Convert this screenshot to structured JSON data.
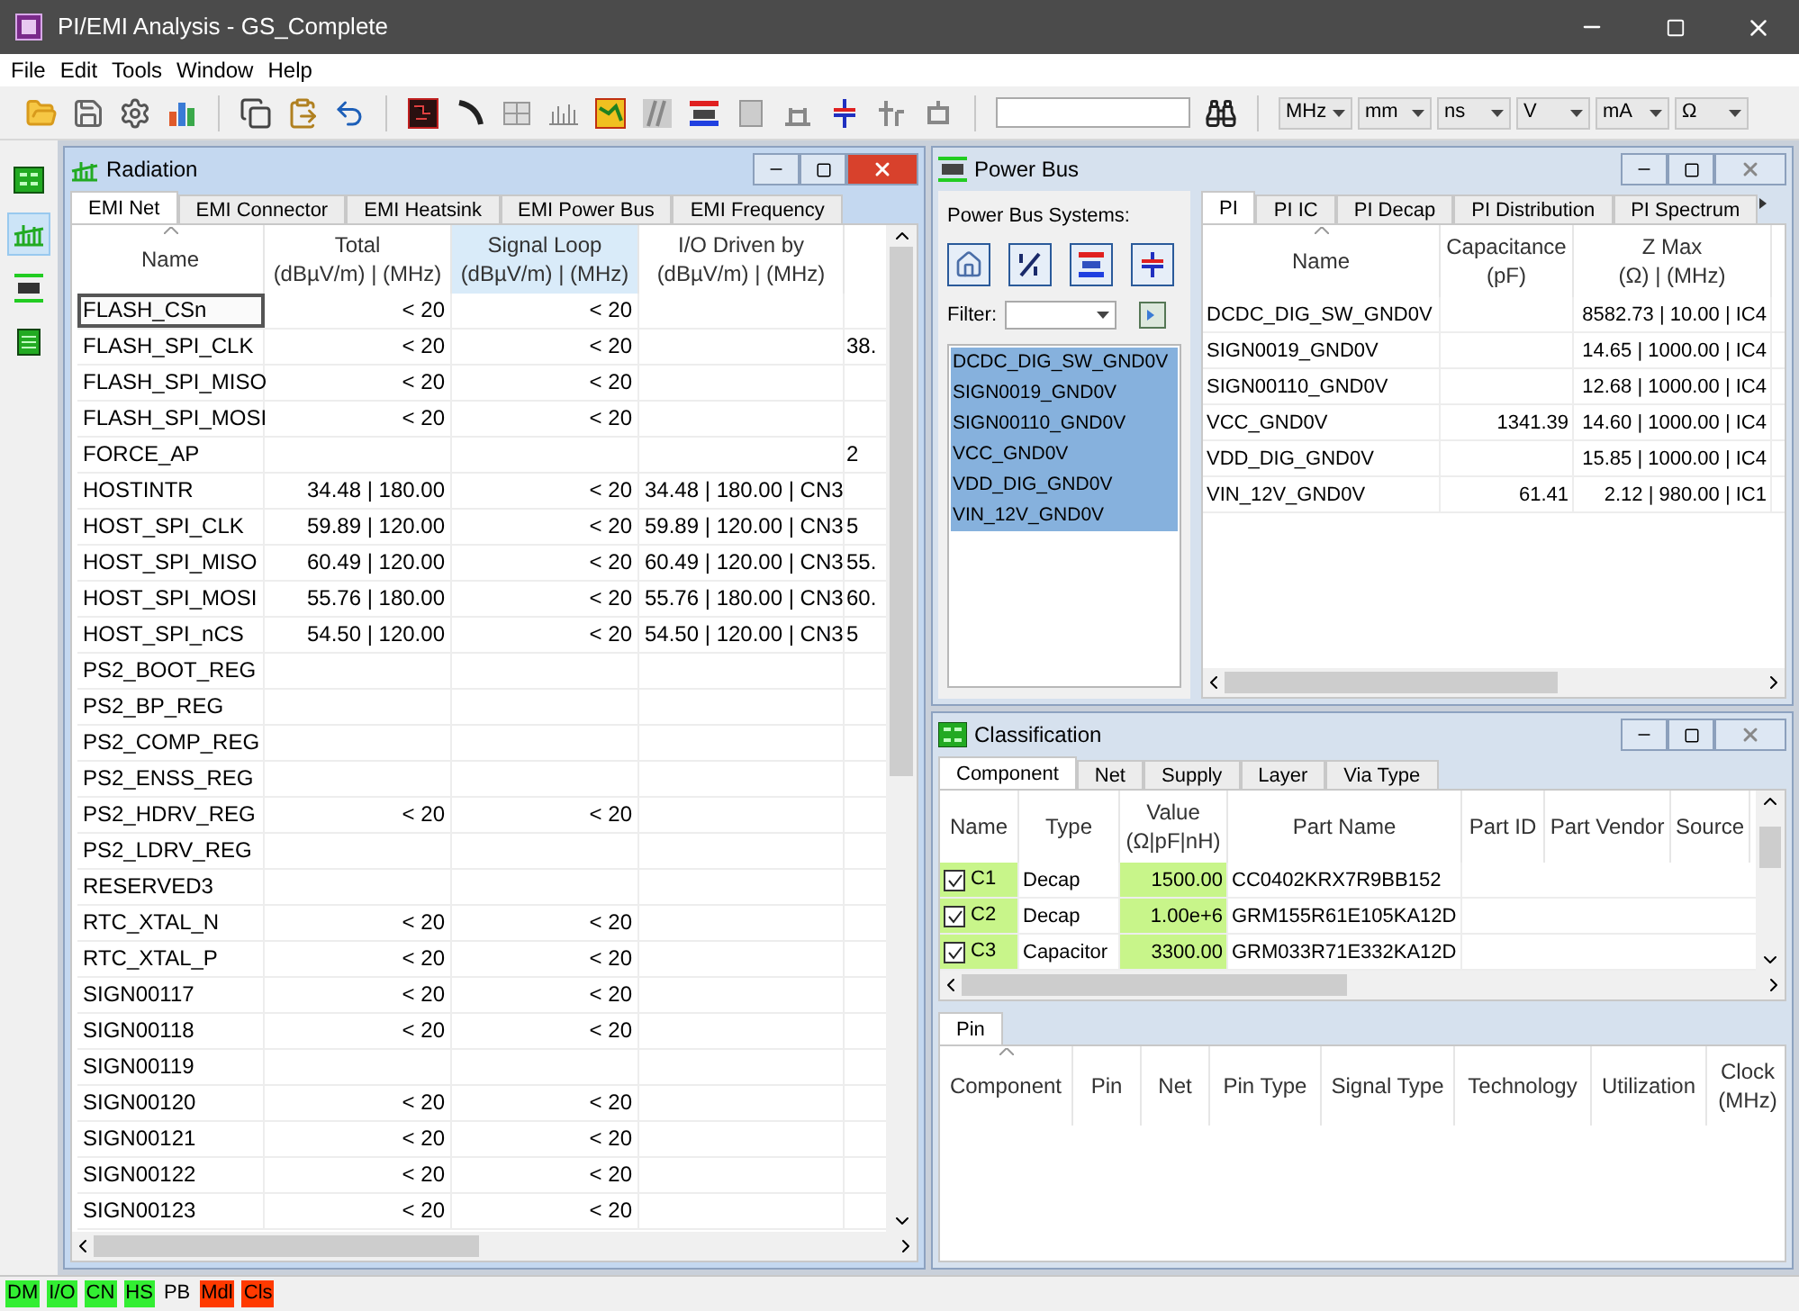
{
  "window": {
    "title": "PI/EMI Analysis - GS_Complete"
  },
  "menu": [
    "File",
    "Edit",
    "Tools",
    "Window",
    "Help"
  ],
  "units": [
    "MHz",
    "mm",
    "ns",
    "V",
    "mA",
    "Ω"
  ],
  "side_tools": [
    {
      "selected": false
    },
    {
      "selected": true
    },
    {
      "selected": false
    },
    {
      "selected": false
    }
  ],
  "radiation": {
    "title": "Radiation",
    "active": true,
    "tabs": [
      {
        "label": "EMI Net",
        "selected": true
      },
      {
        "label": "EMI Connector",
        "selected": false
      },
      {
        "label": "EMI Heatsink",
        "selected": false
      },
      {
        "label": "EMI Power Bus",
        "selected": false
      },
      {
        "label": "EMI Frequency",
        "selected": false
      }
    ],
    "columns": [
      {
        "label": "Name",
        "selected": false
      },
      {
        "label": "Total",
        "unit": "(dBµV/m) | (MHz)",
        "selected": false
      },
      {
        "label": "Signal Loop",
        "unit": "(dBµV/m) | (MHz)",
        "selected": true
      },
      {
        "label": "I/O Driven by",
        "unit": "(dBµV/m) | (MHz)",
        "selected": false
      }
    ],
    "rows": [
      {
        "focused": true,
        "cells": [
          "FLASH_CSn",
          "< 20",
          "< 20",
          null,
          null
        ]
      },
      {
        "focused": false,
        "cells": [
          "FLASH_SPI_CLK",
          "< 20",
          "< 20",
          null,
          "38."
        ]
      },
      {
        "focused": false,
        "cells": [
          "FLASH_SPI_MISO",
          "< 20",
          "< 20",
          null,
          null
        ]
      },
      {
        "focused": false,
        "cells": [
          "FLASH_SPI_MOSI",
          "< 20",
          "< 20",
          null,
          null
        ]
      },
      {
        "focused": false,
        "cells": [
          "FORCE_AP",
          null,
          null,
          null,
          "2"
        ]
      },
      {
        "focused": false,
        "cells": [
          "HOSTINTR",
          "34.48 | 180.00",
          "< 20",
          "34.48 | 180.00 | CN3",
          null
        ]
      },
      {
        "focused": false,
        "cells": [
          "HOST_SPI_CLK",
          "59.89 | 120.00",
          "< 20",
          "59.89 | 120.00 | CN3",
          "5"
        ]
      },
      {
        "focused": false,
        "cells": [
          "HOST_SPI_MISO",
          "60.49 | 120.00",
          "< 20",
          "60.49 | 120.00 | CN3",
          "55."
        ]
      },
      {
        "focused": false,
        "cells": [
          "HOST_SPI_MOSI",
          "55.76 | 180.00",
          "< 20",
          "55.76 | 180.00 | CN3",
          "60."
        ]
      },
      {
        "focused": false,
        "cells": [
          "HOST_SPI_nCS",
          "54.50 | 120.00",
          "< 20",
          "54.50 | 120.00 | CN3",
          "5"
        ]
      },
      {
        "focused": false,
        "cells": [
          "PS2_BOOT_REG",
          null,
          null,
          null,
          null
        ]
      },
      {
        "focused": false,
        "cells": [
          "PS2_BP_REG",
          null,
          null,
          null,
          null
        ]
      },
      {
        "focused": false,
        "cells": [
          "PS2_COMP_REG",
          null,
          null,
          null,
          null
        ]
      },
      {
        "focused": false,
        "cells": [
          "PS2_ENSS_REG",
          null,
          null,
          null,
          null
        ]
      },
      {
        "focused": false,
        "cells": [
          "PS2_HDRV_REG",
          "< 20",
          "< 20",
          null,
          null
        ]
      },
      {
        "focused": false,
        "cells": [
          "PS2_LDRV_REG",
          null,
          null,
          null,
          null
        ]
      },
      {
        "focused": false,
        "cells": [
          "RESERVED3",
          null,
          null,
          null,
          null
        ]
      },
      {
        "focused": false,
        "cells": [
          "RTC_XTAL_N",
          "< 20",
          "< 20",
          null,
          null
        ]
      },
      {
        "focused": false,
        "cells": [
          "RTC_XTAL_P",
          "< 20",
          "< 20",
          null,
          null
        ]
      },
      {
        "focused": false,
        "cells": [
          "SIGN00117",
          "< 20",
          "< 20",
          null,
          null
        ]
      },
      {
        "focused": false,
        "cells": [
          "SIGN00118",
          "< 20",
          "< 20",
          null,
          null
        ]
      },
      {
        "focused": false,
        "cells": [
          "SIGN00119",
          null,
          null,
          null,
          null
        ]
      },
      {
        "focused": false,
        "cells": [
          "SIGN00120",
          "< 20",
          "< 20",
          null,
          null
        ]
      },
      {
        "focused": false,
        "cells": [
          "SIGN00121",
          "< 20",
          "< 20",
          null,
          null
        ]
      },
      {
        "focused": false,
        "cells": [
          "SIGN00122",
          "< 20",
          "< 20",
          null,
          null
        ]
      },
      {
        "focused": false,
        "cells": [
          "SIGN00123",
          "< 20",
          "< 20",
          null,
          null
        ]
      }
    ]
  },
  "power_bus": {
    "title": "Power Bus",
    "active": false,
    "systems_label": "Power Bus Systems:",
    "filter_label": "Filter:",
    "systems": [
      {
        "name": "DCDC_DIG_SW_GND0V",
        "selected": true
      },
      {
        "name": "SIGN0019_GND0V",
        "selected": true
      },
      {
        "name": "SIGN00110_GND0V",
        "selected": true
      },
      {
        "name": "VCC_GND0V",
        "selected": true
      },
      {
        "name": "VDD_DIG_GND0V",
        "selected": true
      },
      {
        "name": "VIN_12V_GND0V",
        "selected": true
      }
    ],
    "tabs": [
      {
        "label": "PI",
        "selected": true
      },
      {
        "label": "PI IC",
        "selected": false
      },
      {
        "label": "PI Decap",
        "selected": false
      },
      {
        "label": "PI Distribution",
        "selected": false
      },
      {
        "label": "PI Spectrum",
        "selected": false
      }
    ],
    "columns": [
      {
        "label": "Name"
      },
      {
        "label": "Capacitance",
        "unit": "(pF)"
      },
      {
        "label": "Z Max",
        "unit": "(Ω) | (MHz)"
      }
    ],
    "rows": [
      {
        "cells": [
          "DCDC_DIG_SW_GND0V",
          null,
          "8582.73 | 10.00 | IC4"
        ]
      },
      {
        "cells": [
          "SIGN0019_GND0V",
          null,
          "14.65 | 1000.00 | IC4"
        ]
      },
      {
        "cells": [
          "SIGN00110_GND0V",
          null,
          "12.68 | 1000.00 | IC4"
        ]
      },
      {
        "cells": [
          "VCC_GND0V",
          "1341.39",
          "14.60 | 1000.00 | IC4"
        ]
      },
      {
        "cells": [
          "VDD_DIG_GND0V",
          null,
          "15.85 | 1000.00 | IC4"
        ]
      },
      {
        "cells": [
          "VIN_12V_GND0V",
          "61.41",
          "2.12 | 980.00 | IC1"
        ]
      }
    ]
  },
  "classification": {
    "title": "Classification",
    "active": false,
    "tabs": [
      {
        "label": "Component",
        "selected": true
      },
      {
        "label": "Net",
        "selected": false
      },
      {
        "label": "Supply",
        "selected": false
      },
      {
        "label": "Layer",
        "selected": false
      },
      {
        "label": "Via Type",
        "selected": false
      }
    ],
    "columns": [
      {
        "label": "Name",
        "highlighted": true
      },
      {
        "label": "Type"
      },
      {
        "label": "Value",
        "unit": "(Ω|pF|nH)",
        "highlighted": true
      },
      {
        "label": "Part Name"
      },
      {
        "label": "Part ID"
      },
      {
        "label": "Part Vendor"
      },
      {
        "label": "Source"
      }
    ],
    "rows": [
      {
        "checked": true,
        "cells": [
          "C1",
          "Decap",
          "1500.00",
          "CC0402KRX7R9BB152"
        ]
      },
      {
        "checked": true,
        "cells": [
          "C2",
          "Decap",
          "1.00e+6",
          "GRM155R61E105KA12D"
        ]
      },
      {
        "checked": true,
        "cells": [
          "C3",
          "Capacitor",
          "3300.00",
          "GRM033R71E332KA12D"
        ]
      }
    ],
    "pin_tabs": [
      {
        "label": "Pin",
        "selected": true
      }
    ],
    "pin_columns": [
      {
        "label": "Component"
      },
      {
        "label": "Pin"
      },
      {
        "label": "Net"
      },
      {
        "label": "Pin Type"
      },
      {
        "label": "Signal Type"
      },
      {
        "label": "Technology"
      },
      {
        "label": "Utilization"
      },
      {
        "label": "Clock",
        "unit": "(MHz)"
      }
    ]
  },
  "status_bar": [
    {
      "label": "DM",
      "color": "#33ee33"
    },
    {
      "label": "I/O",
      "color": "#33ee33"
    },
    {
      "label": "CN",
      "color": "#33ee33"
    },
    {
      "label": "HS",
      "color": "#33ee33"
    },
    {
      "label": "PB"
    },
    {
      "label": "Mdl",
      "color": "#ff3a00"
    },
    {
      "label": "Cls",
      "color": "#ff3a00"
    }
  ]
}
